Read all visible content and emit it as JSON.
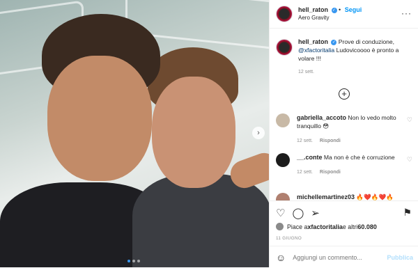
{
  "header": {
    "username": "hell_raton",
    "verified_glyph": "✓",
    "separator": "•",
    "follow_label": "Segui",
    "location": "Aero Gravity",
    "more_glyph": "···"
  },
  "caption": {
    "username": "hell_raton",
    "text_part1": " Prove di conduzione,",
    "mention": "@xfactoritalia",
    "text_part2": " Ludovicoooo è pronto a volare !!!",
    "time": "12 sett."
  },
  "load_more_glyph": "+",
  "comments": [
    {
      "username": "gabriella_accoto",
      "text": " Non lo vedo molto tranquillo 😳",
      "time": "12 sett.",
      "reply_label": "Rispondi",
      "avatar_color": "#c8b9a6"
    },
    {
      "username": "__.conte",
      "text": " Ma non è che è corruzione",
      "time": "12 sett.",
      "reply_label": "Rispondi",
      "avatar_color": "#1c1c1c"
    },
    {
      "username": "michellemartinez03",
      "text": " 🔥❤️🔥❤️🔥",
      "time": "",
      "reply_label": "",
      "avatar_color": "#b08070"
    }
  ],
  "actions": {
    "like_icon": "♡",
    "comment_icon": "◯",
    "share_icon": "➢",
    "bookmark_icon": "⚑",
    "likes_prefix": "Piace a ",
    "likes_user": "xfactoritalia",
    "likes_suffix": " e altri ",
    "likes_count": "60.080",
    "date": "11 GIUGNO"
  },
  "add_comment": {
    "emoji_glyph": "☺",
    "placeholder": "Aggiungi un commento...",
    "publish_label": "Pubblica"
  },
  "carousel": {
    "next_glyph": "›",
    "dot_count": 3,
    "active_index": 0
  },
  "colors": {
    "link_blue": "#0095f6",
    "publish_disabled": "#b2dffc",
    "muted": "#8e8e8e",
    "dot_active": "#3897f0"
  }
}
